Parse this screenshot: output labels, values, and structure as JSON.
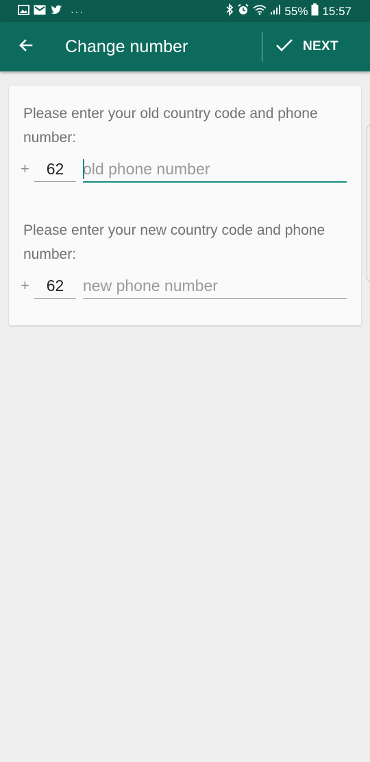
{
  "status_bar": {
    "battery_percent": "55%",
    "time": "15:57",
    "left_icons": [
      "gallery-icon",
      "mail-icon",
      "twitter-icon"
    ],
    "more_indicator": "···"
  },
  "app_bar": {
    "title": "Change number",
    "next_label": "NEXT"
  },
  "form": {
    "old_prompt": "Please enter your old country code and phone number:",
    "old_plus": "+",
    "old_country_code": "62",
    "old_phone_placeholder": "old phone number",
    "new_prompt": "Please enter your new country code and phone number:",
    "new_plus": "+",
    "new_country_code": "62",
    "new_phone_placeholder": "new phone number"
  },
  "colors": {
    "status_bar": "#0b5c4f",
    "app_bar": "#0d6b5d",
    "accent": "#128c7e",
    "background": "#eeeeee",
    "card": "#fafafa"
  }
}
